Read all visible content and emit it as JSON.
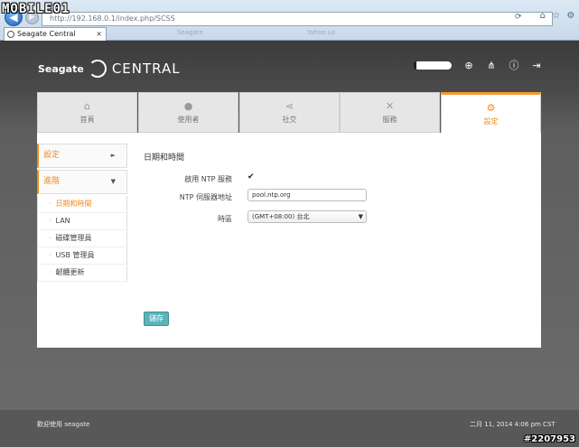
{
  "browser": {
    "url": "http://192.168.0.1/index.php/SCSS",
    "tab_title": "Seagate Central",
    "tab_close": "×",
    "ghost_tabs": [
      "Seagate",
      "Yahoo Lo"
    ],
    "watermark": "MOBILE01"
  },
  "header": {
    "brand": "Seagate",
    "product": "CENTRAL",
    "storage_used_fraction": 0.07,
    "icons": [
      "globe-icon",
      "network-icon",
      "help-icon",
      "logout-icon"
    ]
  },
  "nav": {
    "tabs": [
      {
        "label": "首頁",
        "icon": "home-icon"
      },
      {
        "label": "使用者",
        "icon": "user-icon"
      },
      {
        "label": "社交",
        "icon": "share-icon"
      },
      {
        "label": "服務",
        "icon": "tools-icon"
      },
      {
        "label": "設定",
        "icon": "gears-icon",
        "active": true
      }
    ]
  },
  "sidebar": {
    "sections": [
      {
        "label": "設定",
        "arrow": "►"
      },
      {
        "label": "進階",
        "arrow": "▼"
      }
    ],
    "items": [
      "日期和時間",
      "LAN",
      "磁碟管理員",
      "USB 管理員",
      "韌體更新"
    ],
    "bullet": "·"
  },
  "content": {
    "title": "日期和時間",
    "ntp_enable_label": "啟用 NTP 服務",
    "ntp_enabled": true,
    "ntp_enabled_mark": "✔",
    "ntp_server_label": "NTP 伺服器地址",
    "ntp_server_value": "pool.ntp.org",
    "timezone_label": "時區",
    "timezone_value": "(GMT+08:00) 台北",
    "save_label": "儲存"
  },
  "footer": {
    "welcome": "歡迎使用 seagate",
    "datetime": "二月 11, 2014 4:06 pm CST",
    "post_id": "#2207953"
  }
}
